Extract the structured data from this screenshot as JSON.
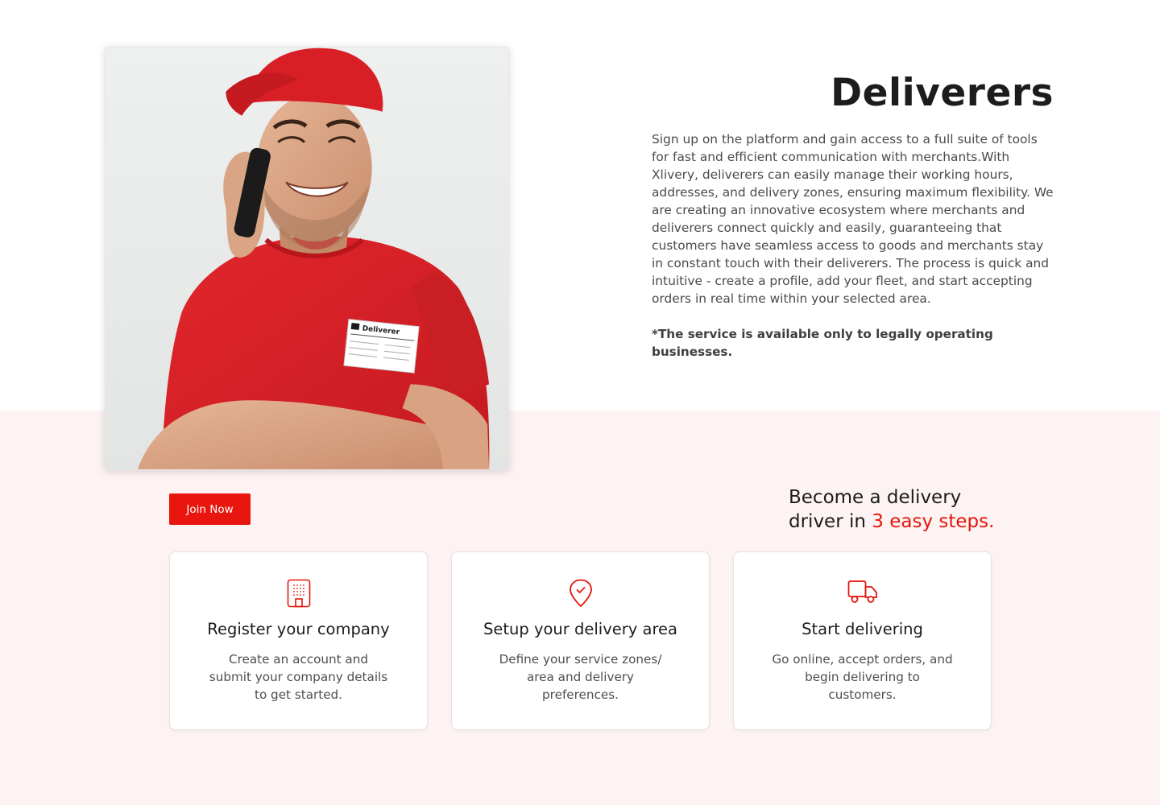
{
  "deliverers": {
    "title": "Deliverers",
    "description": "Sign up on the platform and gain access to a full suite of tools for fast and efficient communication with merchants.With Xlivery, deliverers can easily manage their working hours, addresses, and delivery zones, ensuring maximum flexibility. We are creating an innovative ecosystem where merchants and deliverers connect quickly and easily, guaranteeing that customers have seamless access to goods and merchants stay in constant touch with their deliverers. The process is quick and intuitive - create a profile, add your fleet, and start accepting orders in real time within your selected area.",
    "notice": "*The service is available only to legally operating businesses.",
    "photo_badge_text": "Deliverer"
  },
  "cta": {
    "join_label": "Join Now"
  },
  "steps": {
    "heading_line1": "Become a delivery",
    "heading_line2_prefix": "driver in ",
    "heading_line2_accent": "3 easy steps.",
    "cards": [
      {
        "icon": "building-icon",
        "title": "Register your company",
        "text": "Create an account and submit your company details to get started."
      },
      {
        "icon": "map-pin-check-icon",
        "title": "Setup your delivery area",
        "text": "Define your service zones/ area and delivery preferences."
      },
      {
        "icon": "truck-icon",
        "title": "Start delivering",
        "text": "Go online, accept orders, and begin delivering to customers."
      }
    ]
  },
  "colors": {
    "accent": "#e3160e",
    "section_background": "#fdf3f2",
    "shirt": "#d91f26"
  }
}
